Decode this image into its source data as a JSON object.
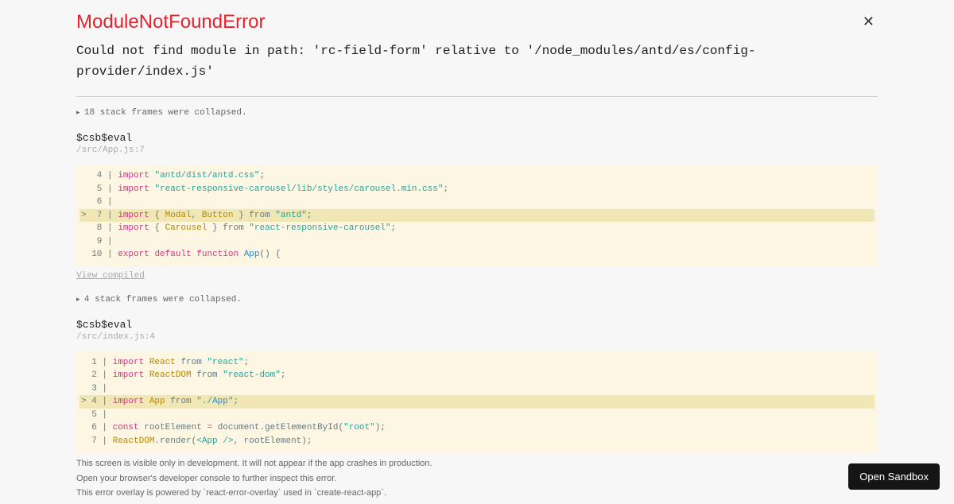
{
  "error": {
    "title": "ModuleNotFoundError",
    "message": "Could not find module in path: 'rc-field-form' relative to '/node_modules/antd/es/config-provider/index.js'"
  },
  "collapsed1": "18 stack frames were collapsed.",
  "frame1": {
    "fn": "$csb$eval",
    "loc": "/src/App.js:7"
  },
  "view_compiled": "View compiled",
  "collapsed2": "4 stack frames were collapsed.",
  "frame2": {
    "fn": "$csb$eval",
    "loc": "/src/index.js:4"
  },
  "footer": {
    "l1": "This screen is visible only in development. It will not appear if the app crashes in production.",
    "l2": "Open your browser's developer console to further inspect this error.",
    "l3": "This error overlay is powered by `react-error-overlay` used in `create-react-app`."
  },
  "sandbox_btn": "Open Sandbox",
  "code1": {
    "l4": {
      "g": "   4 | ",
      "kw": "import",
      "s": "\"antd/dist/antd.css\"",
      "p": ";"
    },
    "l5": {
      "g": "   5 | ",
      "kw": "import",
      "s": "\"react-responsive-carousel/lib/styles/carousel.min.css\"",
      "p": ";"
    },
    "l6": {
      "g": "   6 | "
    },
    "l7": {
      "g": ">  7 | ",
      "kw": "import",
      "b1": " { ",
      "n1": "Modal",
      "c": ", ",
      "n2": "Button",
      "b2": " } ",
      "fr": "from ",
      "s": "\"antd\"",
      "p": ";"
    },
    "l8": {
      "g": "   8 | ",
      "kw": "import",
      "b1": " { ",
      "n1": "Carousel",
      "b2": " } ",
      "fr": "from ",
      "s": "\"react-responsive-carousel\"",
      "p": ";"
    },
    "l9": {
      "g": "   9 | "
    },
    "l10": {
      "g": "  10 | ",
      "k1": "export",
      "k2": "default",
      "k3": "function",
      "fn": "App",
      "p": "() {"
    }
  },
  "code2": {
    "l1": {
      "g": "  1 | ",
      "kw": "import",
      "n": "React",
      "fr": " from ",
      "s": "\"react\"",
      "p": ";"
    },
    "l2": {
      "g": "  2 | ",
      "kw": "import",
      "n": "ReactDOM",
      "fr": " from ",
      "s": "\"react-dom\"",
      "p": ";"
    },
    "l3": {
      "g": "  3 | "
    },
    "l4": {
      "g": "> 4 | ",
      "kw": "import",
      "n": "App",
      "fr": " from ",
      "s1": "\"./",
      "s2": "App",
      "s3": "\"",
      "p": ";"
    },
    "l5": {
      "g": "  5 | "
    },
    "l6": {
      "g": "  6 | ",
      "kw": "const",
      "v": " rootElement ",
      "op": "=",
      "call": " document.getElementById(",
      "s": "\"root\"",
      "p": ");"
    },
    "l7": {
      "g": "  7 | ",
      "n": "ReactDOM",
      "m": ".render(",
      "jsx": "<App />",
      "p": ", rootElement);"
    }
  }
}
